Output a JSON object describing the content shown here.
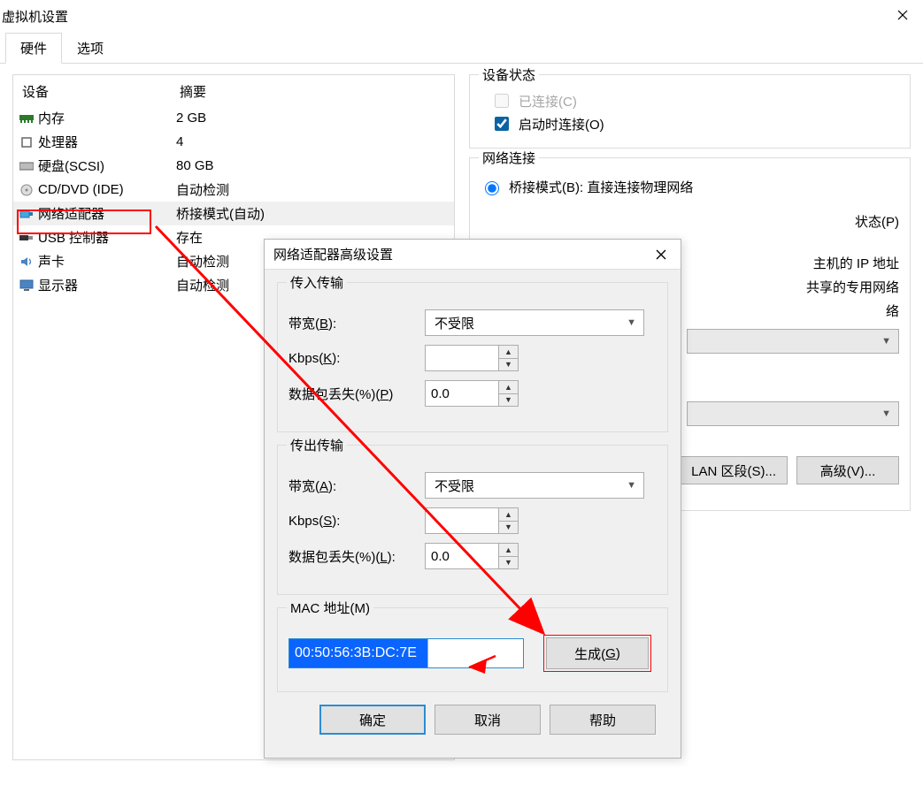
{
  "window": {
    "title": "虚拟机设置",
    "close_tooltip": "关闭"
  },
  "tabs": {
    "hardware": "硬件",
    "options": "选项"
  },
  "list": {
    "header_device": "设备",
    "header_summary": "摘要",
    "rows": [
      {
        "name": "内存",
        "summary": "2 GB",
        "icon": "memory-icon"
      },
      {
        "name": "处理器",
        "summary": "4",
        "icon": "cpu-icon"
      },
      {
        "name": "硬盘(SCSI)",
        "summary": "80 GB",
        "icon": "disk-icon"
      },
      {
        "name": "CD/DVD (IDE)",
        "summary": "自动检测",
        "icon": "cd-icon"
      },
      {
        "name": "网络适配器",
        "summary": "桥接模式(自动)",
        "icon": "nic-icon"
      },
      {
        "name": "USB 控制器",
        "summary": "存在",
        "icon": "usb-icon"
      },
      {
        "name": "声卡",
        "summary": "自动检测",
        "icon": "sound-icon"
      },
      {
        "name": "显示器",
        "summary": "自动检测",
        "icon": "display-icon"
      }
    ]
  },
  "right": {
    "device_status_title": "设备状态",
    "connected_label": "已连接(C)",
    "connect_at_poweron_label": "启动时连接(O)",
    "network_conn_title": "网络连接",
    "bridged_label": "桥接模式(B): 直接连接物理网络",
    "status_label": "状态(P)",
    "host_ip_label": "主机的 IP 地址",
    "host_private_label": "共享的专用网络",
    "net_label": "络",
    "lan_btn": "LAN 区段(S)...",
    "advanced_btn": "高级(V)..."
  },
  "modal": {
    "title": "网络适配器高级设置",
    "in_group": "传入传输",
    "out_group": "传出传输",
    "bandwidth_in_label_pre": "带宽(",
    "bandwidth_in_label_u": "B",
    "bandwidth_in_label_post": "):",
    "bandwidth_out_label_pre": "带宽(",
    "bandwidth_out_label_u": "A",
    "bandwidth_out_label_post": "):",
    "bandwidth_unlimited": "不受限",
    "kbps_in_label_pre": "Kbps(",
    "kbps_in_label_u": "K",
    "kbps_in_label_post": "):",
    "kbps_out_label_pre": "Kbps(",
    "kbps_out_label_u": "S",
    "kbps_out_label_post": "):",
    "kbps_value": "",
    "loss_in_label_pre": "数据包丢失(%)(",
    "loss_in_label_u": "P",
    "loss_in_label_post": ")",
    "loss_out_label_pre": "数据包丢失(%)(",
    "loss_out_label_u": "L",
    "loss_out_label_post": "):",
    "loss_value": "0.0",
    "mac_group_pre": "MAC 地址(",
    "mac_group_u": "M",
    "mac_group_post": ")",
    "mac_value": "00:50:56:3B:DC:7E",
    "generate_pre": "生成(",
    "generate_u": "G",
    "generate_post": ")",
    "ok": "确定",
    "cancel": "取消",
    "help": "帮助"
  }
}
